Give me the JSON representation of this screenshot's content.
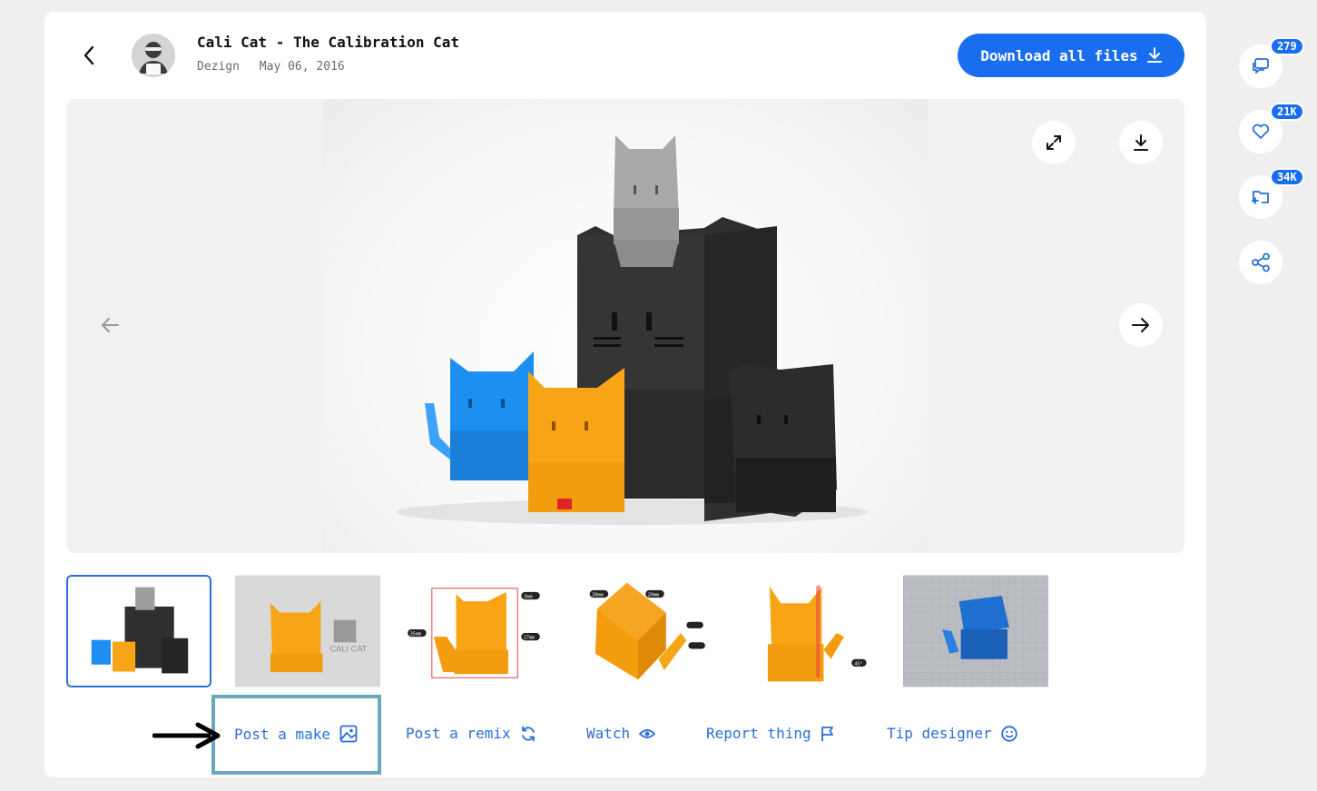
{
  "header": {
    "title": "Cali Cat - The Calibration Cat",
    "author": "Dezign",
    "date": "May 06, 2016",
    "download_label": "Download all files"
  },
  "gallery": {
    "thumbnails": [
      {
        "name": "thumb-cats-group",
        "active": true
      },
      {
        "name": "thumb-orange-cat-logo",
        "active": false
      },
      {
        "name": "thumb-dimensions-front",
        "active": false
      },
      {
        "name": "thumb-dimensions-top",
        "active": false
      },
      {
        "name": "thumb-overhang-side",
        "active": false
      },
      {
        "name": "thumb-blue-render",
        "active": false
      }
    ],
    "thumb_text": {
      "logo": "CALI CAT",
      "dim_5mm": "5mm",
      "dim_35mm": "35mm",
      "dim_27mm": "27mm",
      "dim_20mm_a": "20mm",
      "dim_20mm_b": "20mm",
      "dim_45": "45°"
    }
  },
  "actions": {
    "post_make": "Post a make",
    "post_remix": "Post a remix",
    "watch": "Watch",
    "report": "Report thing",
    "tip": "Tip designer"
  },
  "side": {
    "comments_count": "279",
    "likes_count": "21K",
    "collections_count": "34K"
  },
  "colors": {
    "accent": "#196ef0",
    "link": "#2a6fd6",
    "highlight": "#6aa9bd"
  }
}
